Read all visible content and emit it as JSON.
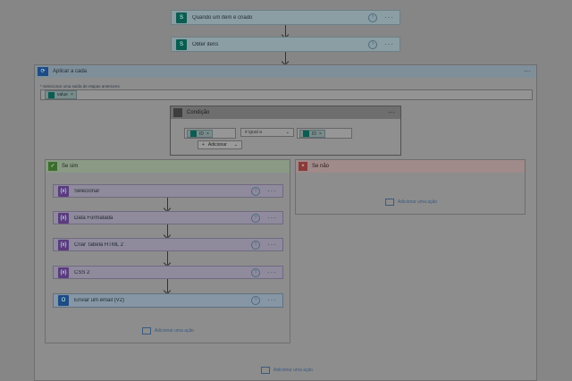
{
  "trigger": {
    "title": "Quando um item é criado",
    "icon": "sharepoint-icon"
  },
  "get_items": {
    "title": "Obter itens",
    "icon": "sharepoint-icon"
  },
  "apply_each": {
    "title": "Aplicar a cada",
    "select_label": "* Selecionar uma saída de etapas anteriores",
    "chip": "value",
    "add_action": "Adicionar uma ação"
  },
  "condition": {
    "title": "Condição",
    "left_chip": "ID",
    "operator": "é igual a",
    "right_chip": "ID",
    "add_label": "Adicionar"
  },
  "branch_yes": {
    "title": "Se sim",
    "steps": [
      {
        "title": "Selecionar",
        "icon": "variable-icon"
      },
      {
        "title": "Data Formatada",
        "icon": "variable-icon"
      },
      {
        "title": "Criar Tabela HTML 2",
        "icon": "variable-icon"
      },
      {
        "title": "CSS 2",
        "icon": "variable-icon"
      },
      {
        "title": "Enviar um email (V2)",
        "icon": "outlook-icon"
      }
    ],
    "add_action": "Adicionar uma ação"
  },
  "branch_no": {
    "title": "Se não",
    "add_action": "Adicionar uma ação"
  },
  "colors": {
    "sharepoint": "#0b5c52",
    "variable": "#5b3b80",
    "outlook": "#1d4c86",
    "yes_header": "#8a9a84",
    "no_header": "#a08a8a"
  }
}
